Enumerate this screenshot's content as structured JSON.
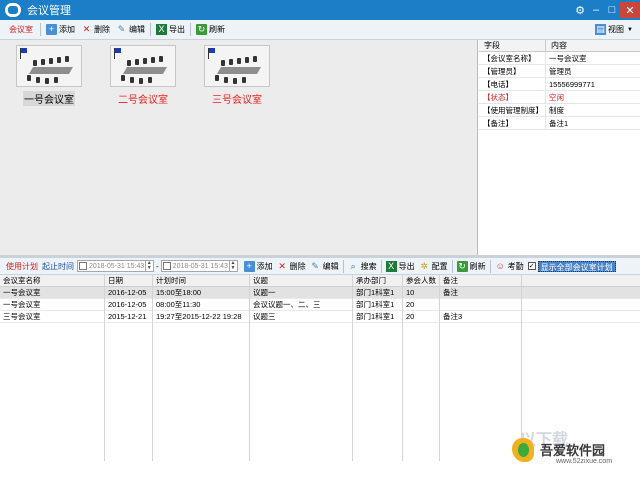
{
  "window": {
    "title": "会议管理"
  },
  "toolbar": {
    "room_tab": "会议室",
    "add": "添加",
    "delete": "删除",
    "edit": "编辑",
    "export": "导出",
    "refresh": "刷新",
    "view": "视图"
  },
  "rooms": [
    {
      "name": "一号会议室"
    },
    {
      "name": "二号会议室"
    },
    {
      "name": "三号会议室"
    }
  ],
  "properties": {
    "header_field": "字段",
    "header_value": "内容",
    "rows": [
      {
        "field": "【会议室名称】",
        "value": "一号会议室"
      },
      {
        "field": "【管理员】",
        "value": "管理员"
      },
      {
        "field": "【电话】",
        "value": "15556999771"
      },
      {
        "field": "【状态】",
        "value": "空闲"
      },
      {
        "field": "【使用管理制度】",
        "value": "制度"
      },
      {
        "field": "【备注】",
        "value": "备注1"
      }
    ]
  },
  "plan_toolbar": {
    "use_plan": "使用计划",
    "time_range": "起止时间",
    "date_from": "2018-05-31 15:43",
    "date_to": "2018-05-31 15:43",
    "add": "添加",
    "delete": "删除",
    "edit": "编辑",
    "search": "搜索",
    "export": "导出",
    "config": "配置",
    "refresh": "刷新",
    "attendance": "考勤",
    "show_all": "显示全部会议室计划"
  },
  "grid": {
    "columns": [
      "会议室名称",
      "日期",
      "计划时间",
      "议题",
      "承办部门",
      "参会人数",
      "备注"
    ],
    "rows": [
      [
        "一号会议室",
        "2016-12-05",
        "15:00至18:00",
        "议题一",
        "部门1科室1",
        "10",
        "备注"
      ],
      [
        "一号会议室",
        "2016-12-05",
        "08:00至11:30",
        "会议议题一、二、三",
        "部门1科室1",
        "20",
        ""
      ],
      [
        "三号会议室",
        "2015-12-21",
        "19:27至2015-12-22 19:28",
        "议题三",
        "部门1科室1",
        "20",
        "备注3"
      ]
    ]
  },
  "watermark": {
    "title": "吾爱软件园",
    "url": "www.52zixue.com",
    "ghost": "以下载"
  }
}
